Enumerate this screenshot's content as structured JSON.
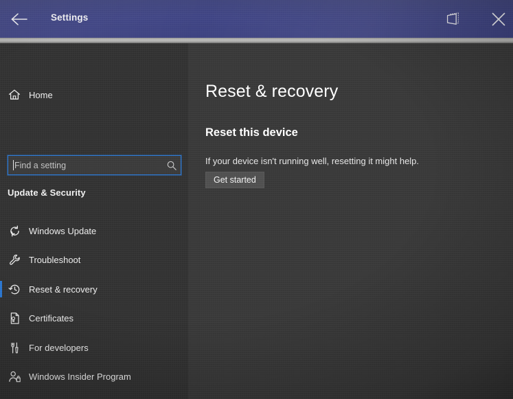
{
  "titlebar": {
    "title": "Settings",
    "back_icon": "back-arrow-icon",
    "restore_icon": "restore-window-icon",
    "close_icon": "close-icon",
    "accent_color": "#3f4484"
  },
  "sidebar": {
    "home_label": "Home",
    "home_icon": "home-icon",
    "search": {
      "placeholder": "Find a setting",
      "value": "",
      "icon": "search-icon"
    },
    "category": "Update & Security",
    "selection_color": "#2a78d4",
    "items": [
      {
        "label": "Windows Update",
        "icon": "refresh-icon",
        "selected": false
      },
      {
        "label": "Troubleshoot",
        "icon": "wrench-icon",
        "selected": false
      },
      {
        "label": "Reset & recovery",
        "icon": "history-clock-icon",
        "selected": true
      },
      {
        "label": "Certificates",
        "icon": "certificate-document-icon",
        "selected": false
      },
      {
        "label": "For developers",
        "icon": "developer-tools-icon",
        "selected": false
      },
      {
        "label": "Windows Insider Program",
        "icon": "person-badge-icon",
        "selected": false
      }
    ]
  },
  "content": {
    "page_title": "Reset & recovery",
    "section_title": "Reset this device",
    "section_description": "If your device isn't running well, resetting it might help.",
    "get_started_label": "Get started"
  }
}
